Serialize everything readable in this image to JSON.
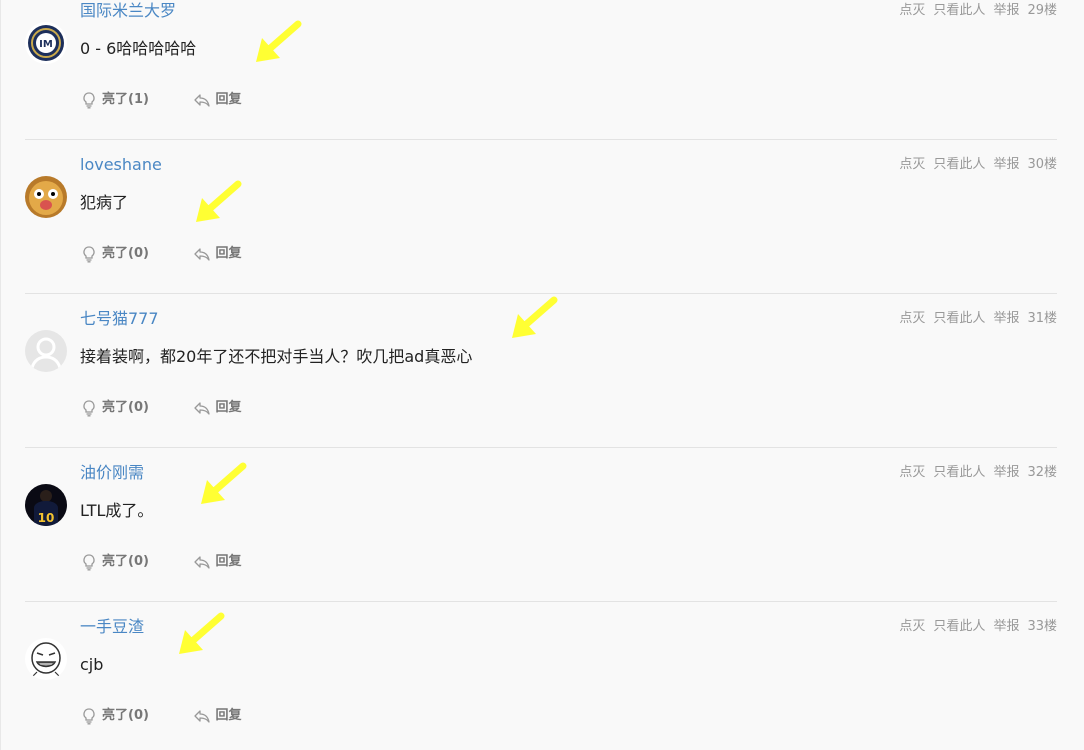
{
  "colors": {
    "username": "#4a87c4",
    "arrow": "#ffff33",
    "muted": "#999999"
  },
  "labels": {
    "zan": "点灭",
    "only_view": "只看此人",
    "report": "举报",
    "reply": "回复"
  },
  "comments": [
    {
      "username": "国际米兰大罗",
      "content": "0 - 6哈哈哈哈哈",
      "floor": "29楼",
      "light_label": "亮了(1)",
      "avatar_icon": "inter-milan-logo"
    },
    {
      "username": "loveshane",
      "content": "犯病了",
      "floor": "30楼",
      "light_label": "亮了(0)",
      "avatar_icon": "cartoon-monkey-face"
    },
    {
      "username": "七号猫777",
      "content": "接着装啊，都20年了还不把对手当人？吹几把ad真恶心",
      "floor": "31楼",
      "light_label": "亮了(0)",
      "avatar_icon": "default-user-silhouette"
    },
    {
      "username": "油价刚需",
      "content": "LTL成了。",
      "floor": "32楼",
      "light_label": "亮了(0)",
      "avatar_icon": "jersey-number-10"
    },
    {
      "username": "一手豆渣",
      "content": "cjb",
      "floor": "33楼",
      "light_label": "亮了(0)",
      "avatar_icon": "meme-face"
    }
  ]
}
